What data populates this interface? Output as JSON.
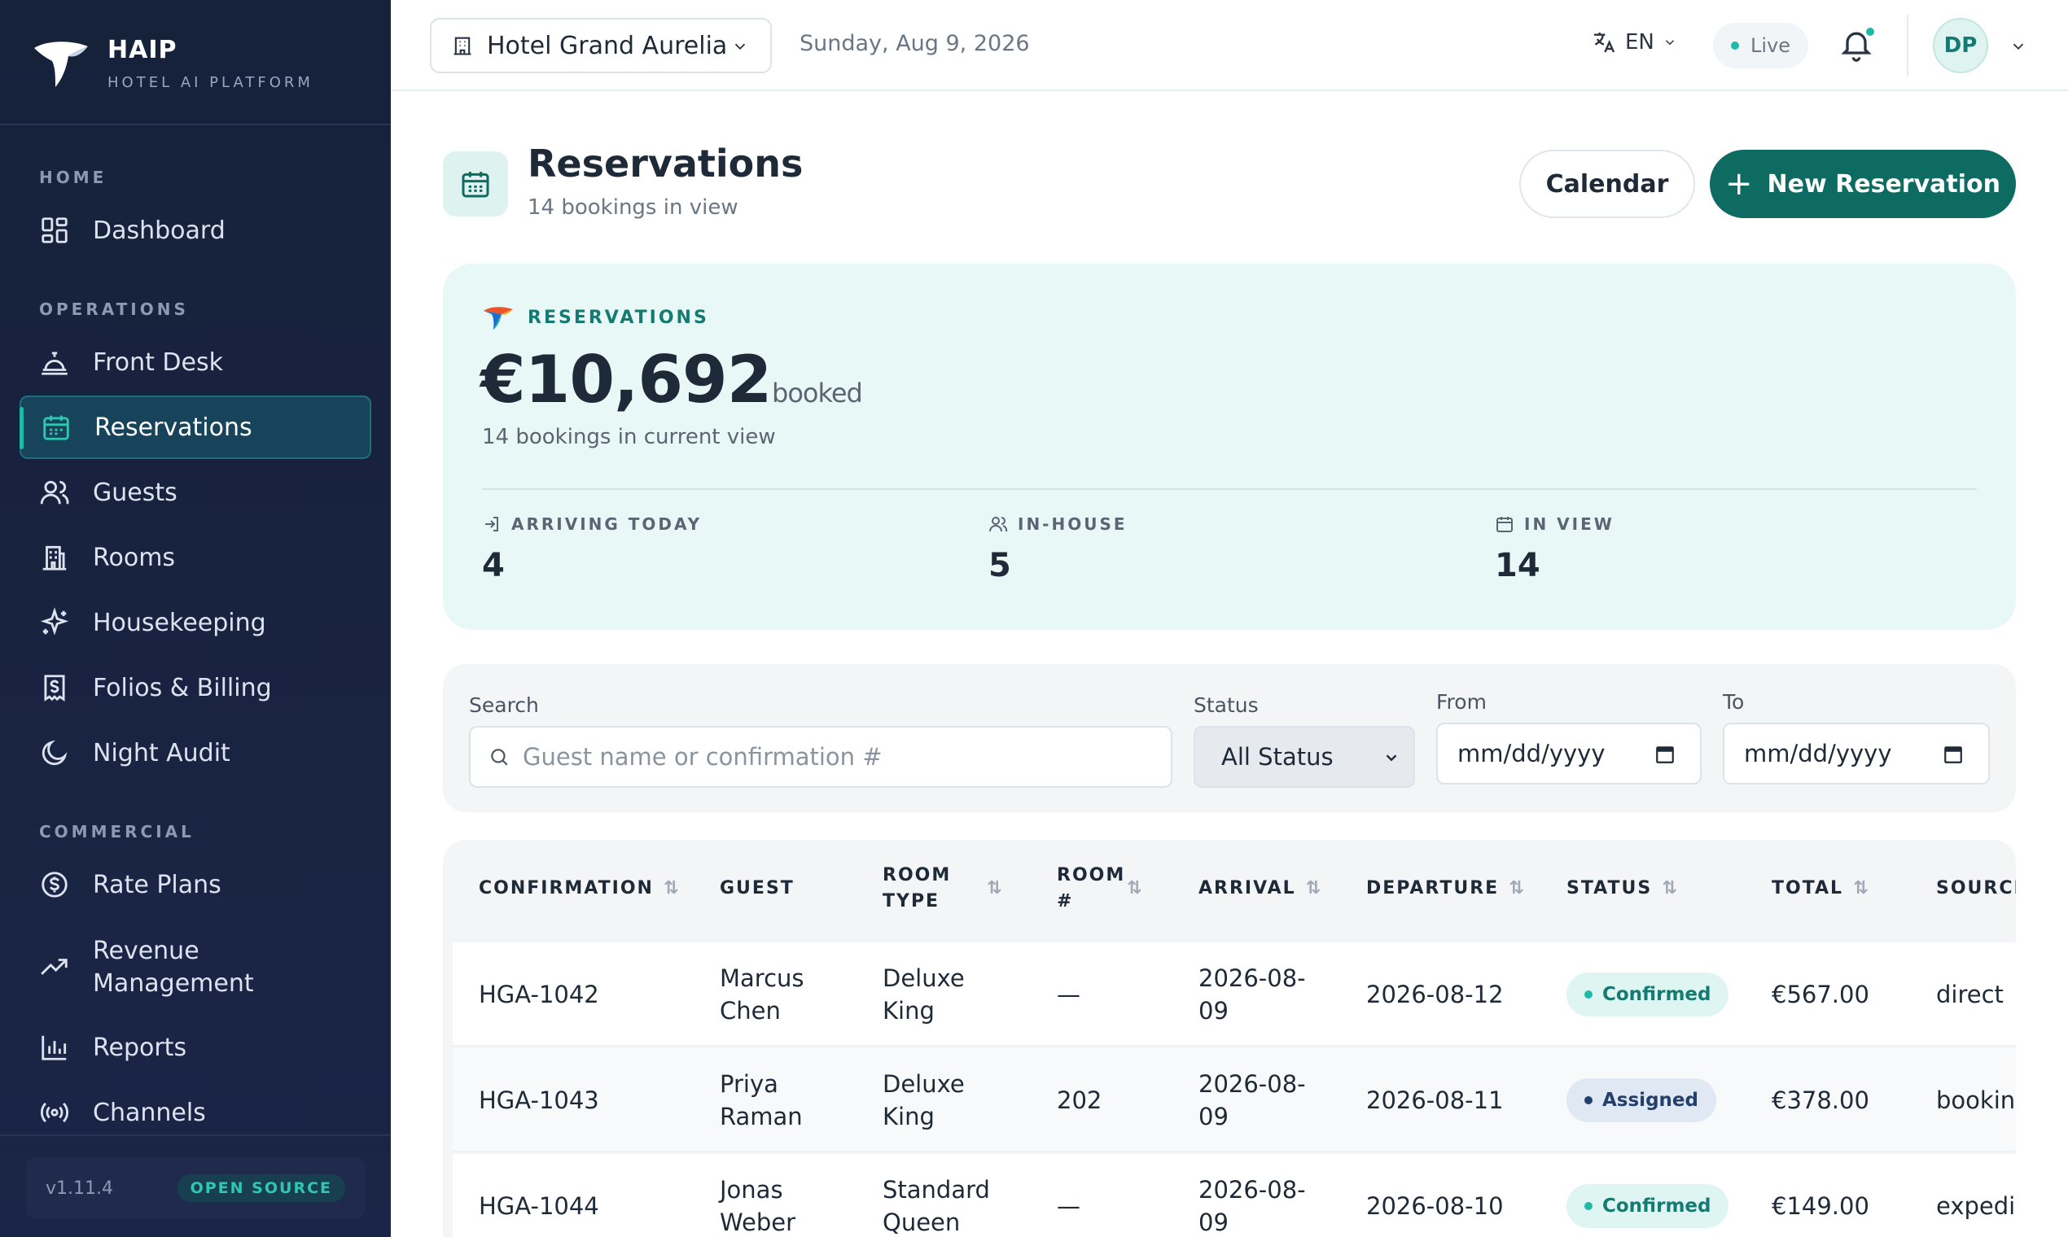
{
  "brand": {
    "name": "HAIP",
    "subtitle": "HOTEL AI PLATFORM"
  },
  "sidebar": {
    "sections": {
      "home": "HOME",
      "operations": "OPERATIONS",
      "commercial": "COMMERCIAL"
    },
    "items": {
      "dashboard": "Dashboard",
      "front_desk": "Front Desk",
      "reservations": "Reservations",
      "guests": "Guests",
      "rooms": "Rooms",
      "housekeeping": "Housekeeping",
      "folios": "Folios & Billing",
      "night_audit": "Night Audit",
      "rate_plans": "Rate Plans",
      "revenue_1": "Revenue",
      "revenue_2": "Management",
      "reports": "Reports",
      "channels": "Channels"
    },
    "active": "reservations",
    "version": "v1.11.4",
    "badge": "OPEN SOURCE"
  },
  "header": {
    "hotel": "Hotel Grand Aurelia",
    "date": "Sunday, Aug 9, 2026",
    "language": "EN",
    "live": "Live",
    "avatar_initials": "DP"
  },
  "page": {
    "title": "Reservations",
    "subtitle": "14 bookings in view",
    "calendar_button": "Calendar",
    "new_button": "New Reservation"
  },
  "summary": {
    "label": "RESERVATIONS",
    "amount": "€10,692",
    "amount_suffix": "booked",
    "sub": "14 bookings in current view",
    "stats": {
      "arriving_label": "ARRIVING TODAY",
      "arriving_value": "4",
      "inhouse_label": "IN-HOUSE",
      "inhouse_value": "5",
      "inview_label": "IN VIEW",
      "inview_value": "14"
    }
  },
  "filters": {
    "search_label": "Search",
    "search_placeholder": "Guest name or confirmation #",
    "status_label": "Status",
    "status_value": "All Status",
    "from_label": "From",
    "from_value": "mm/dd/yyyy",
    "to_label": "To",
    "to_value": "mm/dd/yyyy"
  },
  "table": {
    "headers": {
      "confirmation": "CONFIRMATION",
      "guest": "GUEST",
      "room_type_1": "ROOM",
      "room_type_2": "TYPE",
      "room_no_1": "ROOM",
      "room_no_2": "#",
      "arrival": "ARRIVAL",
      "departure": "DEPARTURE",
      "status": "STATUS",
      "total": "TOTAL",
      "source": "SOURCE"
    },
    "rows": [
      {
        "conf": "HGA-1042",
        "guest_1": "Marcus",
        "guest_2": "Chen",
        "type_1": "Deluxe",
        "type_2": "King",
        "room": "—",
        "arr_1": "2026-08-",
        "arr_2": "09",
        "dep": "2026-08-12",
        "status": "Confirmed",
        "total": "€567.00",
        "source": "direct"
      },
      {
        "conf": "HGA-1043",
        "guest_1": "Priya",
        "guest_2": "Raman",
        "type_1": "Deluxe",
        "type_2": "King",
        "room": "202",
        "arr_1": "2026-08-",
        "arr_2": "09",
        "dep": "2026-08-11",
        "status": "Assigned",
        "total": "€378.00",
        "source": "bookin"
      },
      {
        "conf": "HGA-1044",
        "guest_1": "Jonas",
        "guest_2": "Weber",
        "type_1": "Standard",
        "type_2": "Queen",
        "room": "—",
        "arr_1": "2026-08-",
        "arr_2": "09",
        "dep": "2026-08-10",
        "status": "Confirmed",
        "total": "€149.00",
        "source": "expedia"
      }
    ]
  },
  "colors": {
    "accent": "#0e6b62",
    "teal": "#1fb9a8",
    "sidebar": "#16213a"
  }
}
